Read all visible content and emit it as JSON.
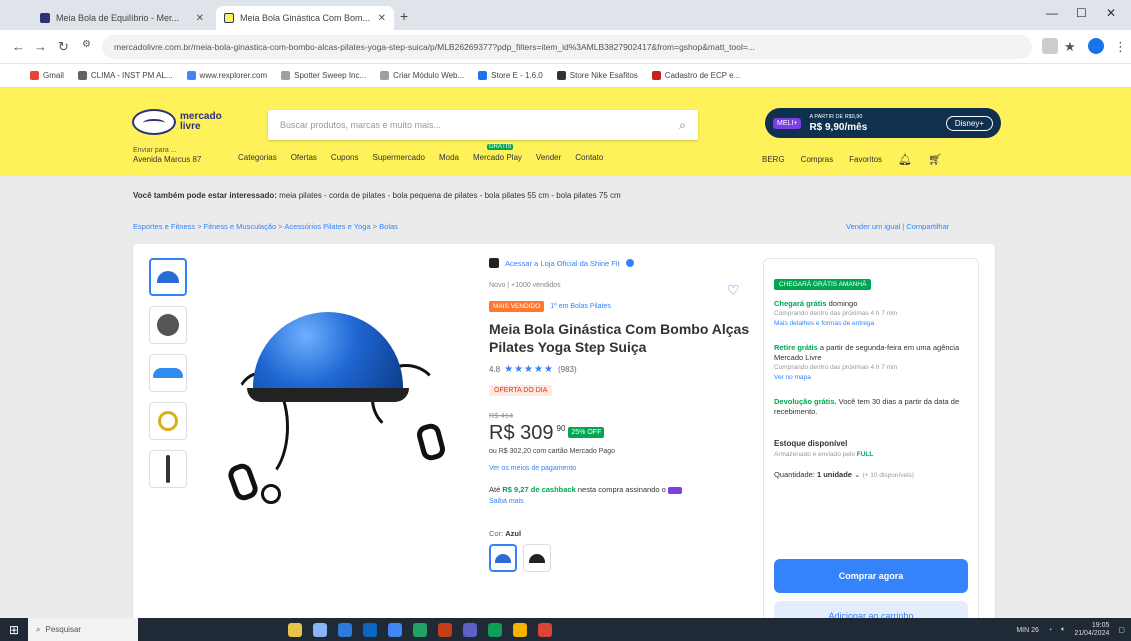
{
  "browser": {
    "tabs": [
      {
        "title": "Meia Bola de Equilíbrio - Mer..."
      },
      {
        "title": "Meia Bola Ginástica Com Bom..."
      }
    ],
    "new_tab": "+",
    "url": "mercadolivre.com.br/meia-bola-ginastica-com-bombo-alcas-pilates-yoga-step-suica/p/MLB26269377?pdp_filters=item_id%3AMLB3827902417&from=gshop&matt_tool=...",
    "bookmarks": [
      "Gmail",
      "CLIMA - INST PM AL...",
      "www.rexplorer.com",
      "Spotter Sweep Inc...",
      "Criar Módulo Web...",
      "Store E - 1.6.0",
      "Store Nike Esafitos",
      "Cadastro de ECP e..."
    ]
  },
  "header": {
    "logo_line1": "mercado",
    "logo_line2": "livre",
    "search_placeholder": "Buscar produtos, marcas e muito mais...",
    "promo_badge": "MELI+",
    "promo_text": "A PARTIR DE R$9,90",
    "promo_price": "R$ 9,90/mês",
    "promo_stream": "Disney+",
    "location_small": "Enviar para ...",
    "location_main": "Avenida Marcus 87",
    "nav": [
      "Categorias",
      "Ofertas",
      "Cupons",
      "Supermercado",
      "Moda",
      "Mercado Play",
      "Vender",
      "Contato"
    ],
    "user": "BERG",
    "user_links": [
      "Compras",
      "Favoritos"
    ]
  },
  "also_bought": {
    "prefix": "Você também pode estar interessado:",
    "items": "meia pilates - corda de pilates - bola pequena de pilates - bola pilates 55 cm - bola pilates 75 cm"
  },
  "breadcrumb": "Esportes e Fitness  >  Fitness e Musculação  >  Acessórios Pilates e Yoga  >  Bolas",
  "sell_same": "Vender um igual  |  Compartilhar",
  "product": {
    "store": "Acessar a Loja Oficial da Shine Fit",
    "meta": "Novo  |  +1000 vendidos",
    "best_seller": "MAIS VENDIDO",
    "rank": "1º em Bolas Pilates",
    "title": "Meia Bola Ginástica Com Bombo Alças Pilates Yoga Step Suiça",
    "rating": "4.8",
    "reviews": "(983)",
    "promo_tag": "OFERTA DO DIA",
    "old_price": "R$ 414",
    "price": "R$ 309",
    "cents": "90",
    "discount": "25% OFF",
    "pix_line": "ou R$ 302,20 com cartão Mercado Pago",
    "payment_link": "Ver os meios de pagamento",
    "cashback_pre": "Até",
    "cashback_value": "R$ 9,27",
    "cashback_label": "de cashback",
    "cashback_post": "nesta compra assinando o",
    "cashback_more": "Saiba mais",
    "color_label": "Cor:",
    "color_value": "Azul"
  },
  "buybox": {
    "free_badge": "CHEGARÁ GRÁTIS AMANHÃ",
    "ship1_title": "Chegará grátis",
    "ship1_day": "domingo",
    "ship1_sub": "Comprando dentro das próximas 4 h 7 min",
    "ship1_link": "Mais detalhes e formas de entrega",
    "ship2_title": "Retire grátis",
    "ship2_text": "a partir de segunda-feira em uma agência Mercado Livre",
    "ship2_sub": "Comprando dentro das próximas 4 h 7 min",
    "ship2_link": "Ver no mapa",
    "ret_title": "Devolução grátis.",
    "ret_text": "Você tem 30 dias a partir da data de recebimento.",
    "stock": "Estoque disponível",
    "stock_sub": "Armazenado e enviado pelo",
    "stock_full": "FULL",
    "qty_label": "Quantidade:",
    "qty_value": "1 unidade",
    "qty_avail": "(+ 10 disponíveis)",
    "buy_btn": "Comprar agora",
    "cart_btn": "Adicionar ao carrinho"
  },
  "taskbar": {
    "search": "Pesquisar",
    "weather": "MIN 26",
    "time": "19:05",
    "date": "21/04/2024"
  },
  "colors": {
    "ml_yellow": "#fff159",
    "ml_blue": "#3483fa",
    "ml_green": "#00a650"
  }
}
